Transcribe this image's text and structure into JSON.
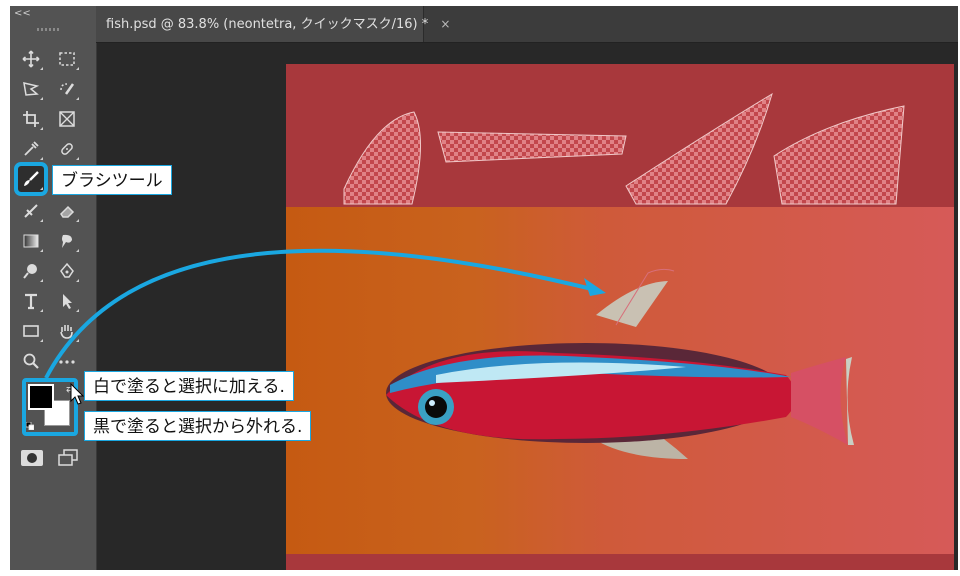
{
  "tabbar": {
    "tab_title": "fish.psd @ 83.8% (neontetra, クイックマスク/16) *",
    "tab_close": "×"
  },
  "toolbar": {
    "collapse_label": "<<",
    "tools": [
      "move-tool",
      "marquee-tool",
      "lasso-tool",
      "quick-select-tool",
      "crop-tool",
      "frame-tool",
      "eyedropper-tool",
      "healing-tool",
      "brush-tool",
      "clone-stamp-tool",
      "eraser-tool",
      "gradient-tool",
      "smudge-tool",
      "dodge-tool",
      "pen-tool",
      "type-tool",
      "path-select-tool",
      "rectangle-tool",
      "hand-tool",
      "zoom-tool",
      "more-tools"
    ],
    "selected_tool": "brush-tool",
    "foreground_color": "#000000",
    "background_color": "#ffffff"
  },
  "callouts": {
    "brush_label": "ブラシツール",
    "white_label": "白で塗ると選択に加える.",
    "black_label": "黒で塗ると選択から外れる."
  },
  "colors": {
    "accent": "#1aa7e1",
    "mask_red": "#a8383c"
  }
}
